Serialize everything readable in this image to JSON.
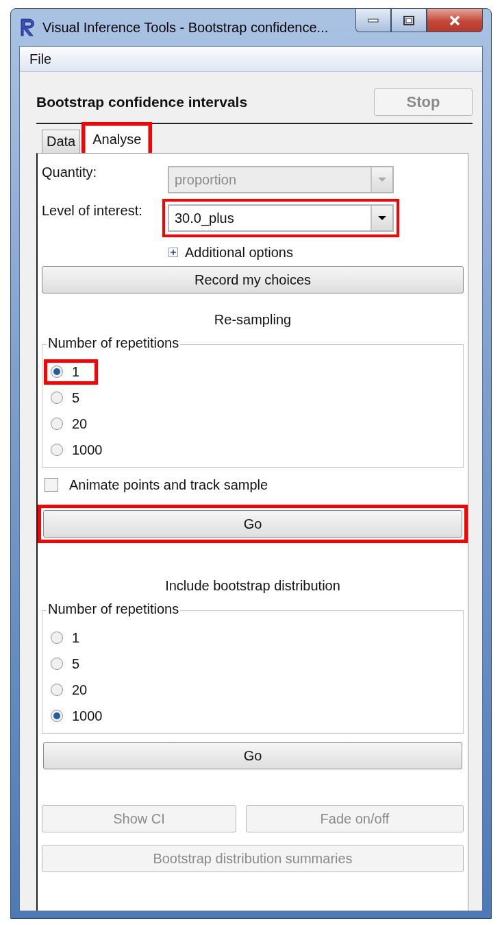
{
  "window": {
    "title": "Visual Inference Tools - Bootstrap confidence..."
  },
  "menu": [
    {
      "label": "File"
    }
  ],
  "heading": "Bootstrap confidence intervals",
  "stop_button": {
    "label": "Stop",
    "disabled": true
  },
  "tabs": [
    {
      "label": "Data",
      "selected": false,
      "highlighted": false
    },
    {
      "label": "Analyse",
      "selected": true,
      "highlighted": true
    }
  ],
  "fields": [
    {
      "label": "Quantity:",
      "value": "proportion",
      "disabled": true,
      "highlighted": false
    },
    {
      "label": "Level of interest:",
      "value": "30.0_plus",
      "disabled": false,
      "highlighted": true
    }
  ],
  "additional_options": {
    "label": "Additional options",
    "expanded": false
  },
  "record_button": {
    "label": "Record my choices"
  },
  "sections": [
    {
      "title": "Re-sampling",
      "group_label": "Number of repetitions",
      "options": [
        {
          "label": "1",
          "selected": true,
          "highlighted": true
        },
        {
          "label": "5",
          "selected": false,
          "highlighted": false
        },
        {
          "label": "20",
          "selected": false,
          "highlighted": false
        },
        {
          "label": "1000",
          "selected": false,
          "highlighted": false
        }
      ],
      "checkbox": {
        "label": "Animate points and track sample",
        "checked": false
      },
      "go": {
        "label": "Go",
        "highlighted": true
      }
    },
    {
      "title": "Include bootstrap distribution",
      "group_label": "Number of repetitions",
      "options": [
        {
          "label": "1",
          "selected": false,
          "highlighted": false
        },
        {
          "label": "5",
          "selected": false,
          "highlighted": false
        },
        {
          "label": "20",
          "selected": false,
          "highlighted": false
        },
        {
          "label": "1000",
          "selected": true,
          "highlighted": false
        }
      ],
      "go": {
        "label": "Go",
        "highlighted": false
      }
    }
  ],
  "bottom_buttons": [
    {
      "label": "Show CI",
      "disabled": true
    },
    {
      "label": "Fade on/off",
      "disabled": true
    }
  ],
  "summary_button": {
    "label": "Bootstrap distribution summaries",
    "disabled": true
  }
}
